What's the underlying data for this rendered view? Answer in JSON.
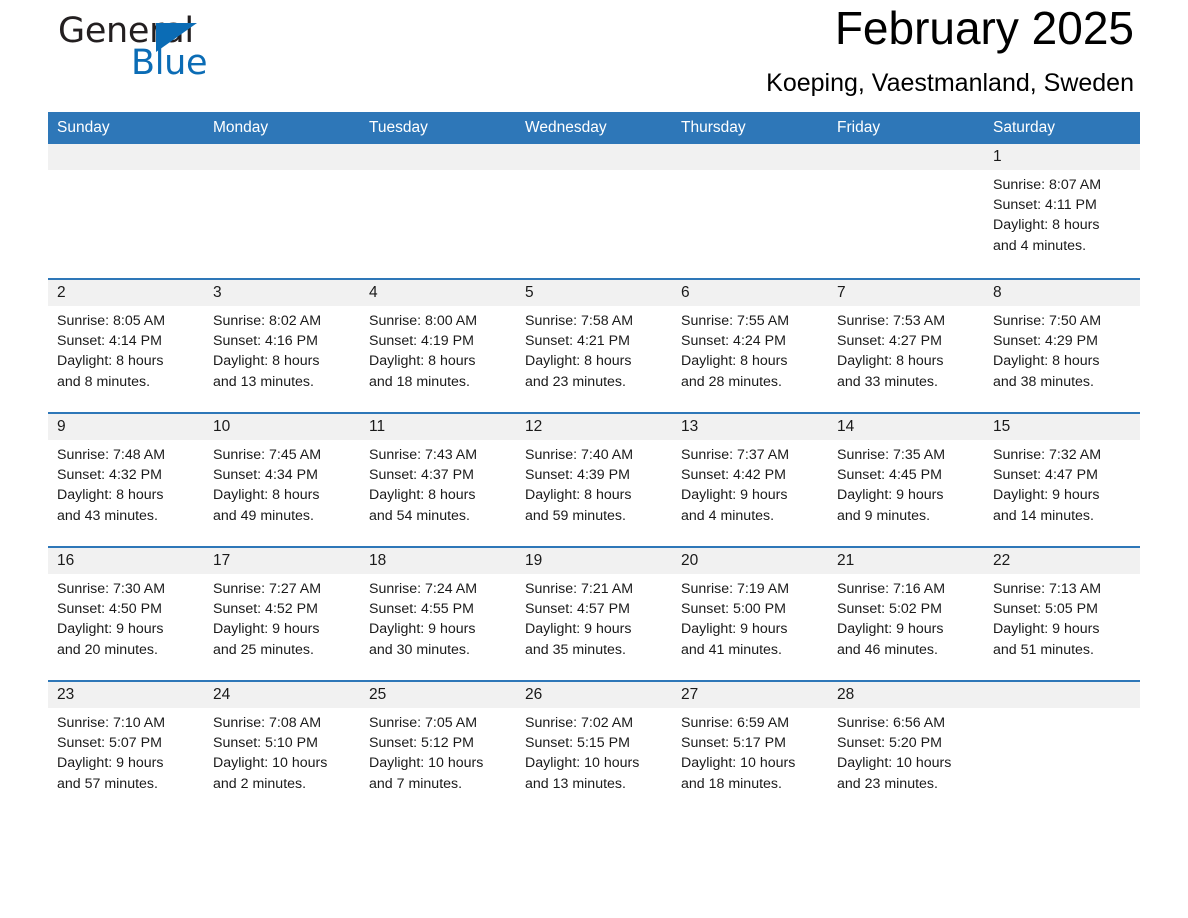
{
  "brand": {
    "name_part1": "General",
    "name_part2": "Blue",
    "triangle_color": "#0b6cb5"
  },
  "header": {
    "title": "February 2025",
    "location": "Koeping, Vaestmanland, Sweden"
  },
  "theme": {
    "header_blue": "#2e77b8",
    "day_band_gray": "#f1f1f1",
    "text_black": "#1a1a1a"
  },
  "weekdays": [
    "Sunday",
    "Monday",
    "Tuesday",
    "Wednesday",
    "Thursday",
    "Friday",
    "Saturday"
  ],
  "weeks": [
    [
      {
        "empty": true
      },
      {
        "empty": true
      },
      {
        "empty": true
      },
      {
        "empty": true
      },
      {
        "empty": true
      },
      {
        "empty": true
      },
      {
        "day": "1",
        "sunrise": "Sunrise: 8:07 AM",
        "sunset": "Sunset: 4:11 PM",
        "daylight_1": "Daylight: 8 hours",
        "daylight_2": "and 4 minutes."
      }
    ],
    [
      {
        "day": "2",
        "sunrise": "Sunrise: 8:05 AM",
        "sunset": "Sunset: 4:14 PM",
        "daylight_1": "Daylight: 8 hours",
        "daylight_2": "and 8 minutes."
      },
      {
        "day": "3",
        "sunrise": "Sunrise: 8:02 AM",
        "sunset": "Sunset: 4:16 PM",
        "daylight_1": "Daylight: 8 hours",
        "daylight_2": "and 13 minutes."
      },
      {
        "day": "4",
        "sunrise": "Sunrise: 8:00 AM",
        "sunset": "Sunset: 4:19 PM",
        "daylight_1": "Daylight: 8 hours",
        "daylight_2": "and 18 minutes."
      },
      {
        "day": "5",
        "sunrise": "Sunrise: 7:58 AM",
        "sunset": "Sunset: 4:21 PM",
        "daylight_1": "Daylight: 8 hours",
        "daylight_2": "and 23 minutes."
      },
      {
        "day": "6",
        "sunrise": "Sunrise: 7:55 AM",
        "sunset": "Sunset: 4:24 PM",
        "daylight_1": "Daylight: 8 hours",
        "daylight_2": "and 28 minutes."
      },
      {
        "day": "7",
        "sunrise": "Sunrise: 7:53 AM",
        "sunset": "Sunset: 4:27 PM",
        "daylight_1": "Daylight: 8 hours",
        "daylight_2": "and 33 minutes."
      },
      {
        "day": "8",
        "sunrise": "Sunrise: 7:50 AM",
        "sunset": "Sunset: 4:29 PM",
        "daylight_1": "Daylight: 8 hours",
        "daylight_2": "and 38 minutes."
      }
    ],
    [
      {
        "day": "9",
        "sunrise": "Sunrise: 7:48 AM",
        "sunset": "Sunset: 4:32 PM",
        "daylight_1": "Daylight: 8 hours",
        "daylight_2": "and 43 minutes."
      },
      {
        "day": "10",
        "sunrise": "Sunrise: 7:45 AM",
        "sunset": "Sunset: 4:34 PM",
        "daylight_1": "Daylight: 8 hours",
        "daylight_2": "and 49 minutes."
      },
      {
        "day": "11",
        "sunrise": "Sunrise: 7:43 AM",
        "sunset": "Sunset: 4:37 PM",
        "daylight_1": "Daylight: 8 hours",
        "daylight_2": "and 54 minutes."
      },
      {
        "day": "12",
        "sunrise": "Sunrise: 7:40 AM",
        "sunset": "Sunset: 4:39 PM",
        "daylight_1": "Daylight: 8 hours",
        "daylight_2": "and 59 minutes."
      },
      {
        "day": "13",
        "sunrise": "Sunrise: 7:37 AM",
        "sunset": "Sunset: 4:42 PM",
        "daylight_1": "Daylight: 9 hours",
        "daylight_2": "and 4 minutes."
      },
      {
        "day": "14",
        "sunrise": "Sunrise: 7:35 AM",
        "sunset": "Sunset: 4:45 PM",
        "daylight_1": "Daylight: 9 hours",
        "daylight_2": "and 9 minutes."
      },
      {
        "day": "15",
        "sunrise": "Sunrise: 7:32 AM",
        "sunset": "Sunset: 4:47 PM",
        "daylight_1": "Daylight: 9 hours",
        "daylight_2": "and 14 minutes."
      }
    ],
    [
      {
        "day": "16",
        "sunrise": "Sunrise: 7:30 AM",
        "sunset": "Sunset: 4:50 PM",
        "daylight_1": "Daylight: 9 hours",
        "daylight_2": "and 20 minutes."
      },
      {
        "day": "17",
        "sunrise": "Sunrise: 7:27 AM",
        "sunset": "Sunset: 4:52 PM",
        "daylight_1": "Daylight: 9 hours",
        "daylight_2": "and 25 minutes."
      },
      {
        "day": "18",
        "sunrise": "Sunrise: 7:24 AM",
        "sunset": "Sunset: 4:55 PM",
        "daylight_1": "Daylight: 9 hours",
        "daylight_2": "and 30 minutes."
      },
      {
        "day": "19",
        "sunrise": "Sunrise: 7:21 AM",
        "sunset": "Sunset: 4:57 PM",
        "daylight_1": "Daylight: 9 hours",
        "daylight_2": "and 35 minutes."
      },
      {
        "day": "20",
        "sunrise": "Sunrise: 7:19 AM",
        "sunset": "Sunset: 5:00 PM",
        "daylight_1": "Daylight: 9 hours",
        "daylight_2": "and 41 minutes."
      },
      {
        "day": "21",
        "sunrise": "Sunrise: 7:16 AM",
        "sunset": "Sunset: 5:02 PM",
        "daylight_1": "Daylight: 9 hours",
        "daylight_2": "and 46 minutes."
      },
      {
        "day": "22",
        "sunrise": "Sunrise: 7:13 AM",
        "sunset": "Sunset: 5:05 PM",
        "daylight_1": "Daylight: 9 hours",
        "daylight_2": "and 51 minutes."
      }
    ],
    [
      {
        "day": "23",
        "sunrise": "Sunrise: 7:10 AM",
        "sunset": "Sunset: 5:07 PM",
        "daylight_1": "Daylight: 9 hours",
        "daylight_2": "and 57 minutes."
      },
      {
        "day": "24",
        "sunrise": "Sunrise: 7:08 AM",
        "sunset": "Sunset: 5:10 PM",
        "daylight_1": "Daylight: 10 hours",
        "daylight_2": "and 2 minutes."
      },
      {
        "day": "25",
        "sunrise": "Sunrise: 7:05 AM",
        "sunset": "Sunset: 5:12 PM",
        "daylight_1": "Daylight: 10 hours",
        "daylight_2": "and 7 minutes."
      },
      {
        "day": "26",
        "sunrise": "Sunrise: 7:02 AM",
        "sunset": "Sunset: 5:15 PM",
        "daylight_1": "Daylight: 10 hours",
        "daylight_2": "and 13 minutes."
      },
      {
        "day": "27",
        "sunrise": "Sunrise: 6:59 AM",
        "sunset": "Sunset: 5:17 PM",
        "daylight_1": "Daylight: 10 hours",
        "daylight_2": "and 18 minutes."
      },
      {
        "day": "28",
        "sunrise": "Sunrise: 6:56 AM",
        "sunset": "Sunset: 5:20 PM",
        "daylight_1": "Daylight: 10 hours",
        "daylight_2": "and 23 minutes."
      },
      {
        "empty": true
      }
    ]
  ]
}
